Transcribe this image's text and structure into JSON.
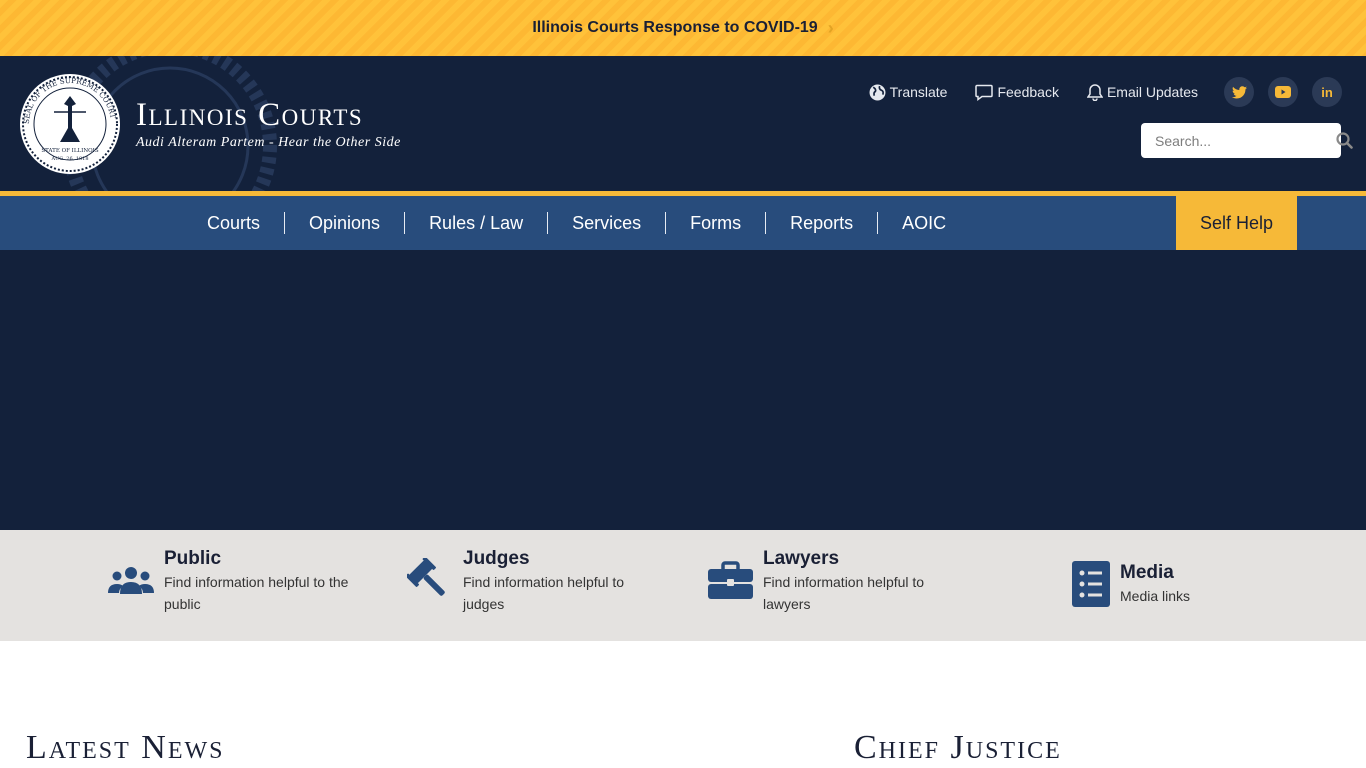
{
  "alert": {
    "text": "Illinois Courts Response to COVID-19",
    "chevron": "›"
  },
  "header": {
    "title": "Illinois Courts",
    "tagline": "Audi Alteram Partem - Hear the Other Side",
    "seal": {
      "ring_text": "SEAL OF THE SUPREME COURT",
      "state": "STATE OF ILLINOIS",
      "date": "AUG. 26, 1818"
    },
    "utility": [
      {
        "label": "Translate",
        "icon": "globe-icon"
      },
      {
        "label": "Feedback",
        "icon": "comment-icon"
      },
      {
        "label": "Email Updates",
        "icon": "bell-icon"
      }
    ],
    "social": [
      {
        "name": "twitter-icon",
        "glyph": "t"
      },
      {
        "name": "youtube-icon",
        "glyph": "▶"
      },
      {
        "name": "linkedin-icon",
        "glyph": "in"
      }
    ],
    "search": {
      "placeholder": "Search...",
      "value": ""
    }
  },
  "nav": {
    "items": [
      "Courts",
      "Opinions",
      "Rules / Law",
      "Services",
      "Forms",
      "Reports",
      "AOIC"
    ],
    "self_help": "Self Help"
  },
  "audience": [
    {
      "title": "Public",
      "desc": "Find information helpful to the public",
      "icon": "users-icon"
    },
    {
      "title": "Judges",
      "desc": "Find information helpful to judges",
      "icon": "gavel-icon"
    },
    {
      "title": "Lawyers",
      "desc": "Find information helpful to lawyers",
      "icon": "briefcase-icon"
    },
    {
      "title": "Media",
      "desc": "Media links",
      "icon": "list-icon"
    }
  ],
  "sections": {
    "latest_news": "Latest News",
    "chief_justice": "Chief Justice"
  },
  "colors": {
    "navy": "#13213b",
    "nav_blue": "#284c7c",
    "gold": "#f6b938",
    "icon_blue": "#284c7c",
    "strip_gray": "#e4e2e0"
  }
}
